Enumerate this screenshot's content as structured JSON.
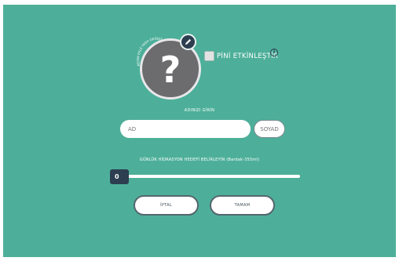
{
  "profile": {
    "avatar_placeholder": "?",
    "avatar_arc_label": "RESİM EKLE YADA DEĞİŞTİR"
  },
  "pin": {
    "label": "PİNİ ETKİNLEŞTİR",
    "checked": false
  },
  "name_section": {
    "title": "ADINIZI GİRİN",
    "first_name_placeholder": "AD",
    "last_name_placeholder": "SOYAD"
  },
  "hydration": {
    "title": "GÜNLÜK HİDRASYON HEDEFİ BELİRLEYİN (Bardak-355ml)",
    "value": "0"
  },
  "actions": {
    "cancel_label": "İPTAL",
    "ok_label": "TAMAM"
  },
  "colors": {
    "background": "#4daf9a",
    "accent_dark": "#2c3e50",
    "avatar": "#6c6b6e"
  }
}
